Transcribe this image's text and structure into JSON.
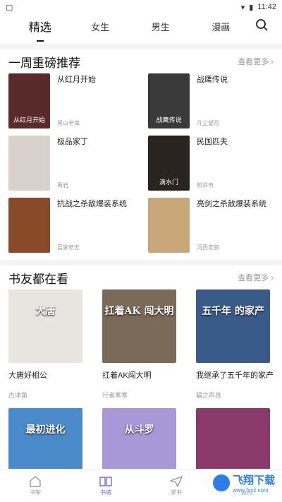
{
  "status": {
    "time": "11:42"
  },
  "tabs": [
    "精选",
    "女生",
    "男生",
    "漫画"
  ],
  "section1": {
    "title": "一周重磅推荐",
    "more": "查看更多 ›",
    "books": [
      {
        "title": "从红月开始",
        "author": "黑山老鬼",
        "cover_text": "从红月开始",
        "bg": "#5a2a2a"
      },
      {
        "title": "战鹰传说",
        "author": "凡尘望月",
        "cover_text": "战鹰传说",
        "bg": "#3a3a3a"
      },
      {
        "title": "极品家丁",
        "author": "禹岩",
        "cover_text": "",
        "bg": "#d8d0cc"
      },
      {
        "title": "民国匹夫",
        "author": "射洪市",
        "cover_text": "滴水门",
        "bg": "#2a2420"
      },
      {
        "title": "抗战之杀敌爆装系统",
        "author": "蓝家老五",
        "cover_text": "",
        "bg": "#8a4a2a"
      },
      {
        "title": "亮剑之杀敌爆装系统",
        "author": "河西走狼",
        "cover_text": "",
        "bg": "#c8a878"
      }
    ]
  },
  "section2": {
    "title": "书友都在看",
    "more": "查看更多 ›",
    "books": [
      {
        "title": "大唐好相公",
        "author": "古沐鱼",
        "cover_text": "大唐",
        "bg": "#e8e4e0"
      },
      {
        "title": "扛着AK闯大明",
        "author": "行者寒寒",
        "cover_text": "扛着AK 闯大明",
        "bg": "#7a6a58"
      },
      {
        "title": "我继承了五千年的家产",
        "author": "猫之声息",
        "cover_text": "五千年 的家产",
        "bg": "#3a5a8a"
      },
      {
        "title": "",
        "author": "",
        "cover_text": "最初进化",
        "bg": "#4a8ac8"
      },
      {
        "title": "",
        "author": "",
        "cover_text": "从斗罗",
        "bg": "#a898d8"
      },
      {
        "title": "",
        "author": "",
        "cover_text": "",
        "bg": "#8a3a6a"
      }
    ]
  },
  "bottom_nav": [
    {
      "label": "书架",
      "icon": "home-icon"
    },
    {
      "label": "书城",
      "icon": "book-icon"
    },
    {
      "label": "求书",
      "icon": "send-icon"
    },
    {
      "label": "我的",
      "icon": "user-icon"
    }
  ],
  "watermark": {
    "text": "飞翔下载",
    "url": "www.fxxz.com"
  },
  "colors": {
    "accent": "#7a6bd8"
  }
}
